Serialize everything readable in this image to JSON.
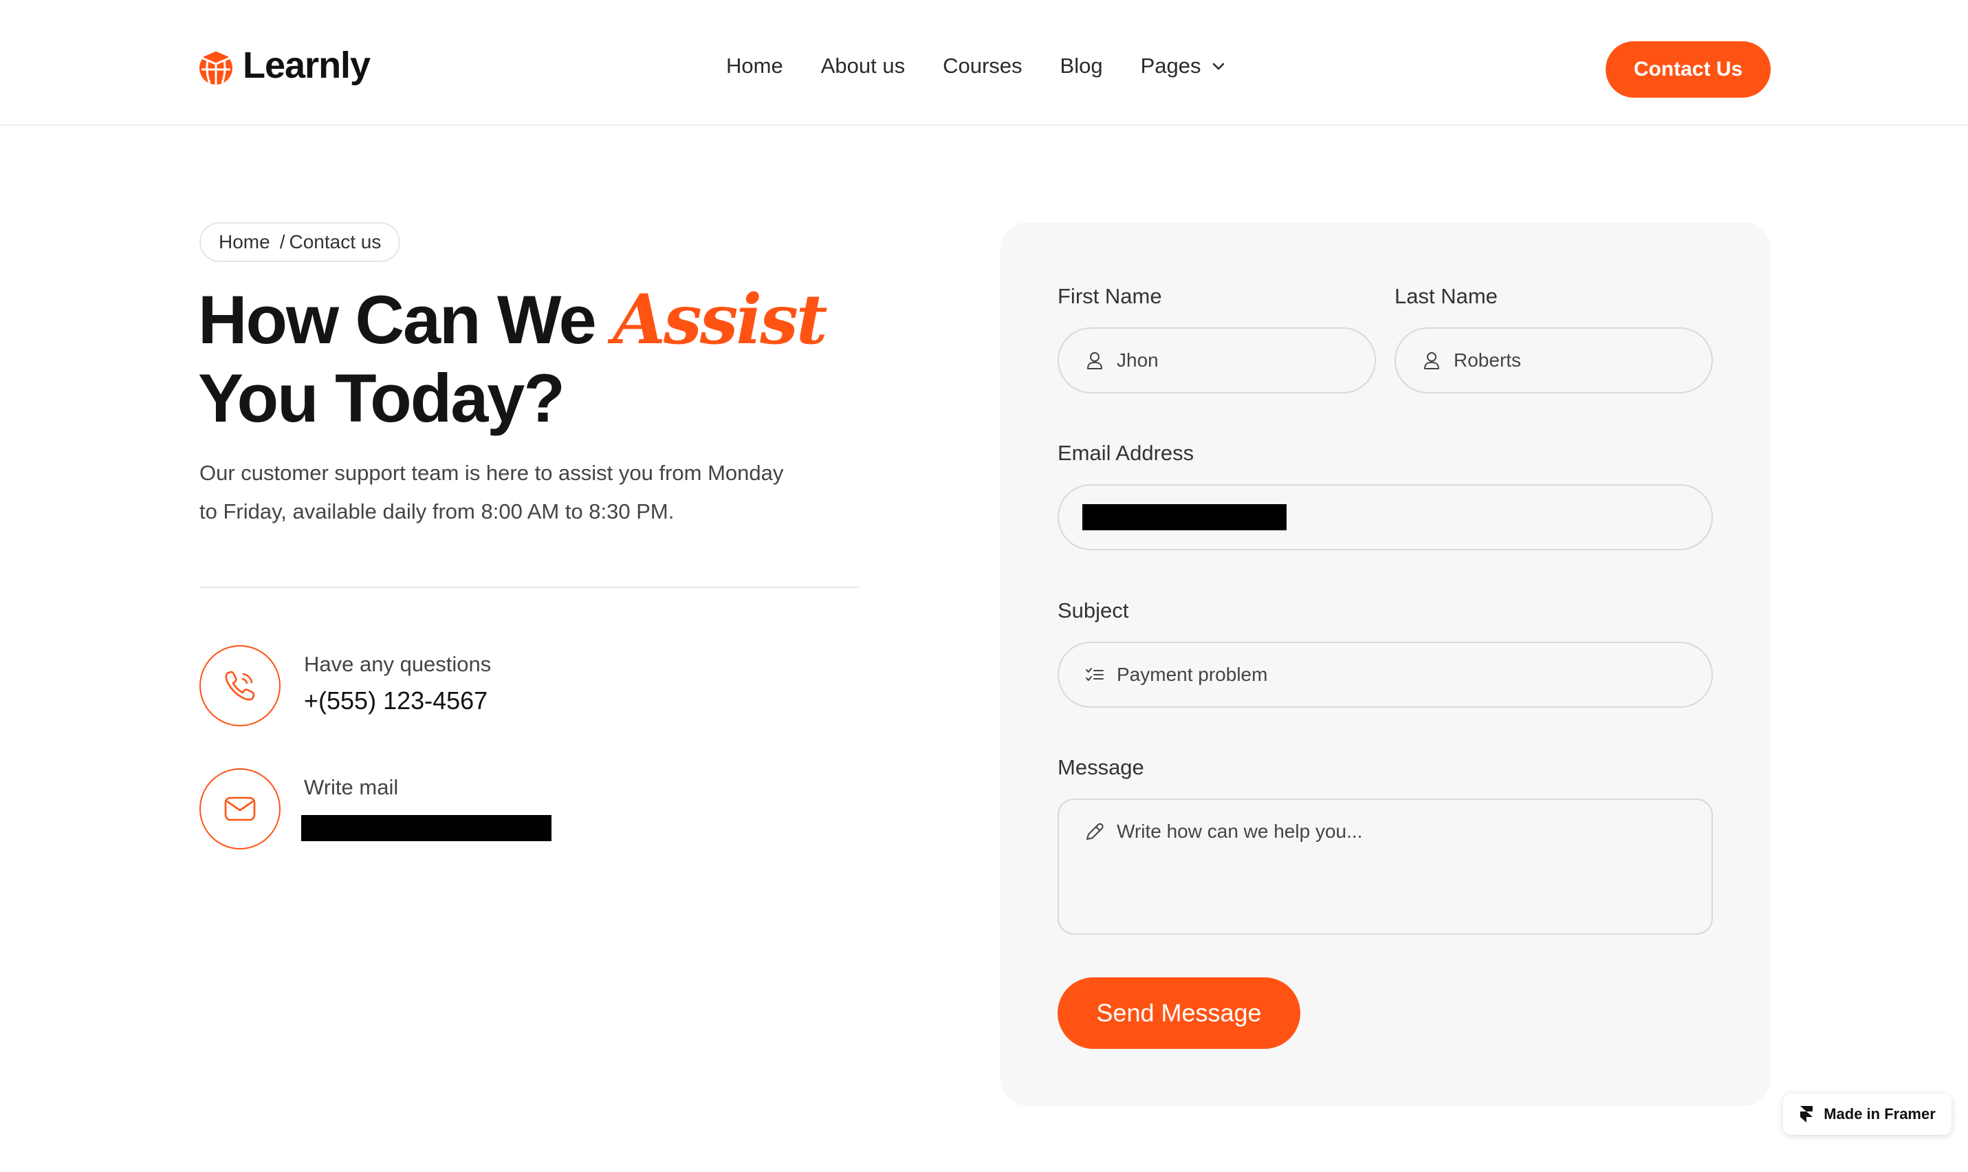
{
  "brand": {
    "name": "Learnly",
    "accent_color": "#ff5314"
  },
  "nav": {
    "items": [
      {
        "label": "Home"
      },
      {
        "label": "About us"
      },
      {
        "label": "Courses"
      },
      {
        "label": "Blog"
      },
      {
        "label": "Pages",
        "icon": "chevron-down-icon"
      }
    ],
    "cta_label": "Contact Us"
  },
  "breadcrumb": {
    "home": "Home",
    "separator": "/",
    "current": "Contact us"
  },
  "hero": {
    "title_part1": "How Can We",
    "title_accent": "Assist",
    "title_part2": "You Today?",
    "description": "Our customer support team is here to assist you from Monday to Friday, available daily from 8:00 AM to 8:30 PM."
  },
  "contact_info": {
    "phone": {
      "label": "Have any questions",
      "value": "+(555) 123-4567",
      "icon": "phone-icon"
    },
    "mail": {
      "label": "Write mail",
      "value_redacted": true,
      "icon": "mail-icon"
    }
  },
  "form": {
    "first_name": {
      "label": "First Name",
      "value": "Jhon",
      "icon": "user-icon"
    },
    "last_name": {
      "label": "Last Name",
      "value": "Roberts",
      "icon": "user-icon"
    },
    "email": {
      "label": "Email Address",
      "value_redacted": true
    },
    "subject": {
      "label": "Subject",
      "value": "Payment problem",
      "icon": "list-icon"
    },
    "message": {
      "label": "Message",
      "placeholder": "Write how can we help you...",
      "icon": "pencil-icon"
    },
    "submit_label": "Send Message"
  },
  "framer_badge": {
    "label": "Made in Framer"
  }
}
